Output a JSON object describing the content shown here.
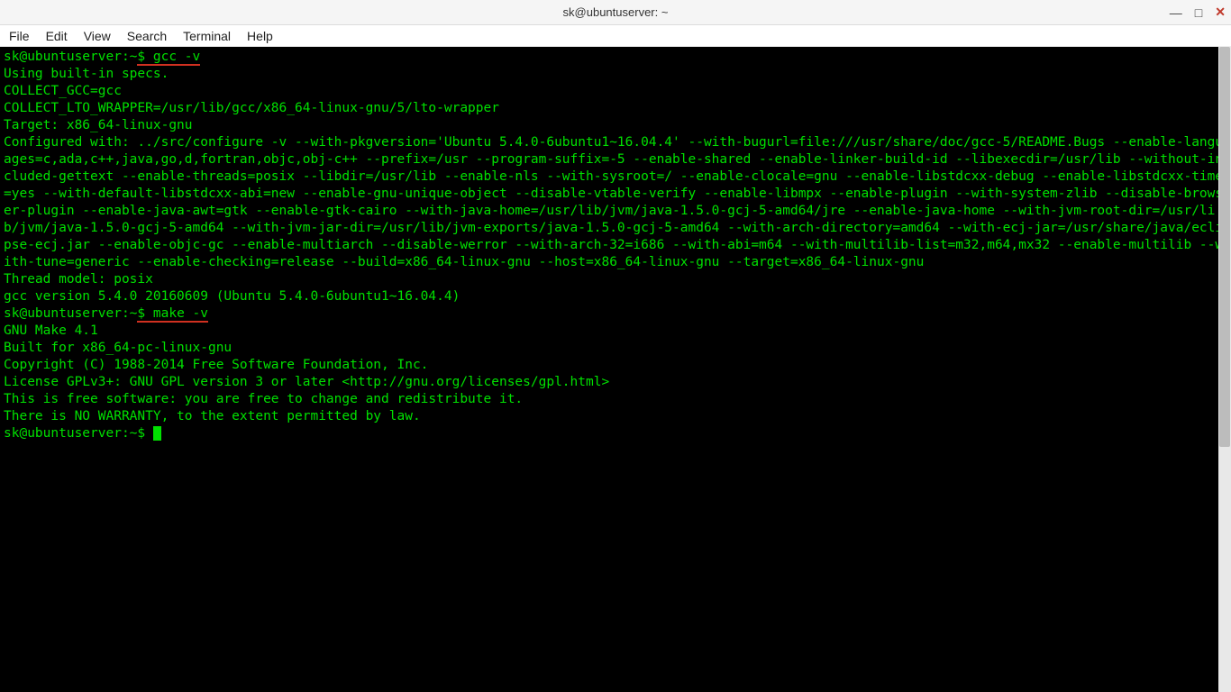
{
  "window": {
    "title": "sk@ubuntuserver: ~"
  },
  "menu": {
    "file": "File",
    "edit": "Edit",
    "view": "View",
    "search": "Search",
    "terminal": "Terminal",
    "help": "Help"
  },
  "term": {
    "prompt1": "sk@ubuntuserver:~",
    "dollar1": "$ ",
    "cmd1": "gcc -v",
    "line2": "Using built-in specs.",
    "line3": "COLLECT_GCC=gcc",
    "line4": "COLLECT_LTO_WRAPPER=/usr/lib/gcc/x86_64-linux-gnu/5/lto-wrapper",
    "line5": "Target: x86_64-linux-gnu",
    "line6": "Configured with: ../src/configure -v --with-pkgversion='Ubuntu 5.4.0-6ubuntu1~16.04.4' --with-bugurl=file:///usr/share/doc/gcc-5/README.Bugs --enable-languages=c,ada,c++,java,go,d,fortran,objc,obj-c++ --prefix=/usr --program-suffix=-5 --enable-shared --enable-linker-build-id --libexecdir=/usr/lib --without-included-gettext --enable-threads=posix --libdir=/usr/lib --enable-nls --with-sysroot=/ --enable-clocale=gnu --enable-libstdcxx-debug --enable-libstdcxx-time=yes --with-default-libstdcxx-abi=new --enable-gnu-unique-object --disable-vtable-verify --enable-libmpx --enable-plugin --with-system-zlib --disable-browser-plugin --enable-java-awt=gtk --enable-gtk-cairo --with-java-home=/usr/lib/jvm/java-1.5.0-gcj-5-amd64/jre --enable-java-home --with-jvm-root-dir=/usr/lib/jvm/java-1.5.0-gcj-5-amd64 --with-jvm-jar-dir=/usr/lib/jvm-exports/java-1.5.0-gcj-5-amd64 --with-arch-directory=amd64 --with-ecj-jar=/usr/share/java/eclipse-ecj.jar --enable-objc-gc --enable-multiarch --disable-werror --with-arch-32=i686 --with-abi=m64 --with-multilib-list=m32,m64,mx32 --enable-multilib --with-tune=generic --enable-checking=release --build=x86_64-linux-gnu --host=x86_64-linux-gnu --target=x86_64-linux-gnu",
    "line7": "Thread model: posix",
    "line8": "gcc version 5.4.0 20160609 (Ubuntu 5.4.0-6ubuntu1~16.04.4)",
    "prompt2": "sk@ubuntuserver:~",
    "dollar2": "$ ",
    "cmd2": "make -v",
    "line10": "GNU Make 4.1",
    "line11": "Built for x86_64-pc-linux-gnu",
    "line12": "Copyright (C) 1988-2014 Free Software Foundation, Inc.",
    "line13": "License GPLv3+: GNU GPL version 3 or later <http://gnu.org/licenses/gpl.html>",
    "line14": "This is free software: you are free to change and redistribute it.",
    "line15": "There is NO WARRANTY, to the extent permitted by law.",
    "prompt3": "sk@ubuntuserver:~",
    "dollar3": "$ "
  },
  "controls": {
    "min": "—",
    "max": "□",
    "close": "✕"
  }
}
